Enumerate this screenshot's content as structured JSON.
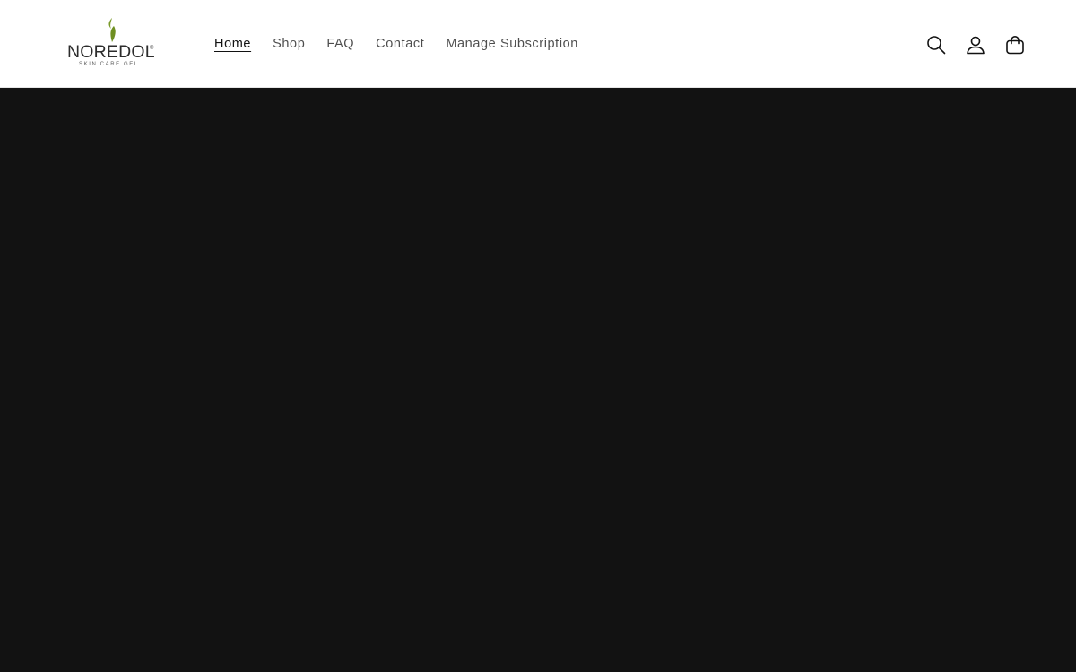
{
  "brand": {
    "name": "NOREDOL",
    "registered_mark": "®",
    "tagline": "SKIN CARE GEL",
    "leaf_color": "#7a9a2a"
  },
  "nav": {
    "items": [
      {
        "label": "Home",
        "active": true
      },
      {
        "label": "Shop",
        "active": false
      },
      {
        "label": "FAQ",
        "active": false
      },
      {
        "label": "Contact",
        "active": false
      },
      {
        "label": "Manage Subscription",
        "active": false
      }
    ]
  },
  "header_icons": [
    "search-icon",
    "account-icon",
    "cart-icon"
  ],
  "colors": {
    "header_bg": "#ffffff",
    "hero_bg": "#121212",
    "text": "#121212"
  }
}
